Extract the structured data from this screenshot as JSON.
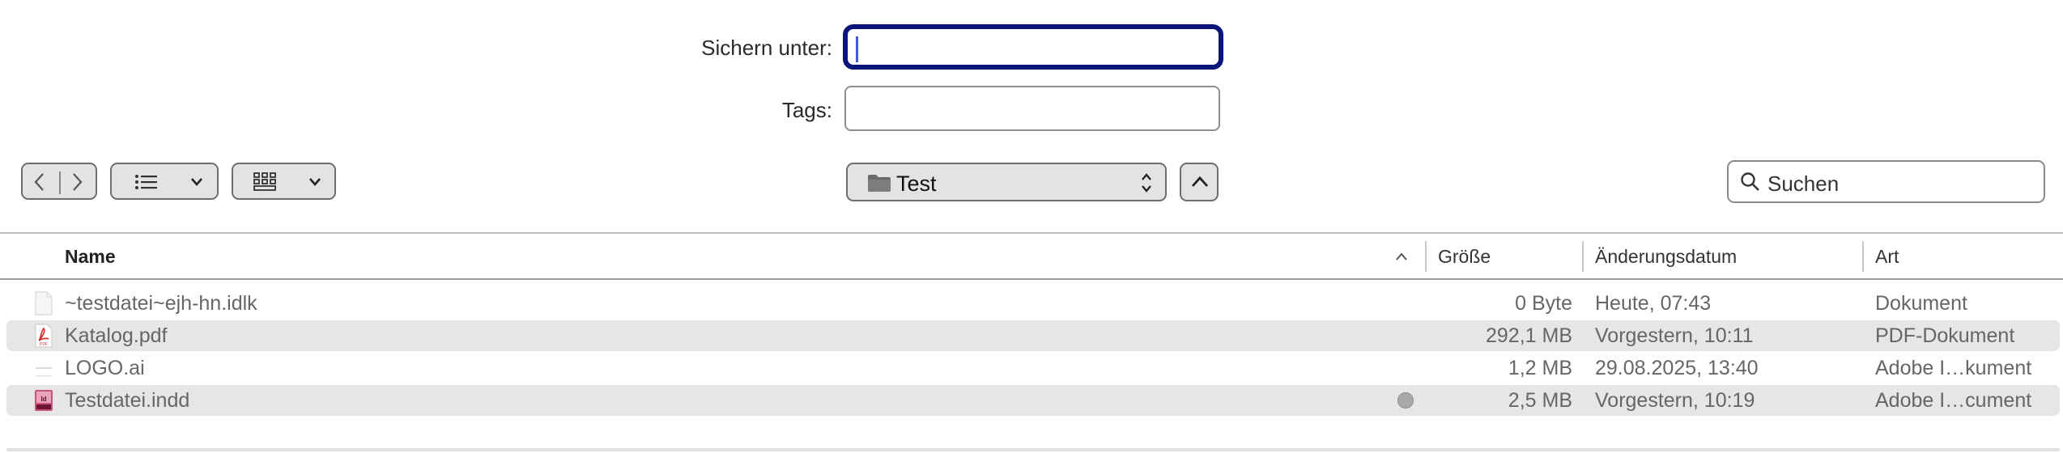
{
  "save_as": {
    "label": "Sichern unter:",
    "value": ""
  },
  "tags": {
    "label": "Tags:",
    "value": ""
  },
  "toolbar": {
    "back_forward_icon": "chevron-left-right",
    "view_list_icon": "list-view",
    "view_grid_icon": "grid-view",
    "location": "Test",
    "search_placeholder": "Suchen"
  },
  "columns": {
    "name": "Name",
    "size": "Größe",
    "modified": "Änderungsdatum",
    "kind": "Art"
  },
  "files": [
    {
      "icon": "generic-document",
      "name": "~testdatei~ejh-hn.idlk",
      "size": "0 Byte",
      "modified": "Heute, 07:43",
      "kind": "Dokument",
      "tag": false
    },
    {
      "icon": "pdf-document",
      "name": "Katalog.pdf",
      "size": "292,1 MB",
      "modified": "Vorgestern, 10:11",
      "kind": "PDF-Dokument",
      "tag": false
    },
    {
      "icon": "illustrator-document",
      "name": "LOGO.ai",
      "size": "1,2 MB",
      "modified": "29.08.2025, 13:40",
      "kind": "Adobe I…kument",
      "tag": false
    },
    {
      "icon": "indesign-document",
      "name": "Testdatei.indd",
      "size": "2,5 MB",
      "modified": "Vorgestern, 10:19",
      "kind": "Adobe I…cument",
      "tag": true
    }
  ],
  "colors": {
    "focus_ring": "#0b1478",
    "row_alt": "#e6e6e6",
    "pdf_red": "#d62c2c",
    "indd_pink": "#c8547f"
  }
}
